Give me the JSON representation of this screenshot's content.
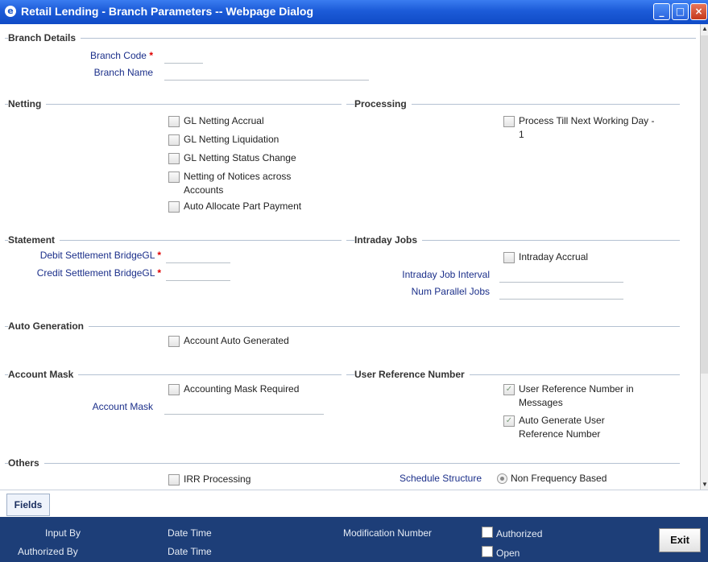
{
  "window": {
    "title": "Retail Lending - Branch Parameters -- Webpage Dialog",
    "icon": "e",
    "minimize": "_",
    "maximize": "□",
    "close": "×"
  },
  "branch_details": {
    "heading": "Branch Details",
    "branch_code_label": "Branch Code",
    "branch_code_value": "",
    "branch_name_label": "Branch Name",
    "branch_name_value": ""
  },
  "netting": {
    "heading": "Netting",
    "items": [
      "GL Netting Accrual",
      "GL Netting Liquidation",
      "GL Netting Status Change",
      "Netting of Notices across Accounts",
      "Auto Allocate Part Payment"
    ]
  },
  "processing": {
    "heading": "Processing",
    "process_till": "Process Till Next Working Day - 1"
  },
  "statement": {
    "heading": "Statement",
    "debit_label": "Debit Settlement BridgeGL",
    "debit_value": "",
    "credit_label": "Credit Settlement BridgeGL",
    "credit_value": ""
  },
  "intraday": {
    "heading": "Intraday Jobs",
    "accrual_label": "Intraday Accrual",
    "interval_label": "Intraday Job Interval",
    "interval_value": "",
    "parallel_label": "Num Parallel Jobs",
    "parallel_value": ""
  },
  "auto_generation": {
    "heading": "Auto Generation",
    "account_auto": "Account Auto Generated"
  },
  "account_mask": {
    "heading": "Account Mask",
    "mask_required": "Accounting Mask Required",
    "mask_label": "Account Mask",
    "mask_value": ""
  },
  "user_ref": {
    "heading": "User Reference Number",
    "in_messages": "User Reference Number in Messages",
    "in_messages_checked": true,
    "auto_generate": "Auto Generate User Reference Number",
    "auto_generate_checked": true
  },
  "others": {
    "heading": "Others",
    "irr": "IRR Processing",
    "schedule_label": "Schedule Structure",
    "schedule_option": "Non Frequency Based"
  },
  "required_marker": "*",
  "check_mark": "✓",
  "tabs": {
    "fields": "Fields"
  },
  "footer": {
    "input_by": "Input By",
    "date_time_1": "Date Time",
    "modification_number": "Modification Number",
    "authorized": "Authorized",
    "authorized_by": "Authorized By",
    "date_time_2": "Date Time",
    "open": "Open",
    "exit": "Exit"
  },
  "colors": {
    "title_bar": "#1c5bd8",
    "footer_bg": "#1d3e78",
    "label_blue": "#1b2f8a",
    "required_red": "#e00000"
  }
}
